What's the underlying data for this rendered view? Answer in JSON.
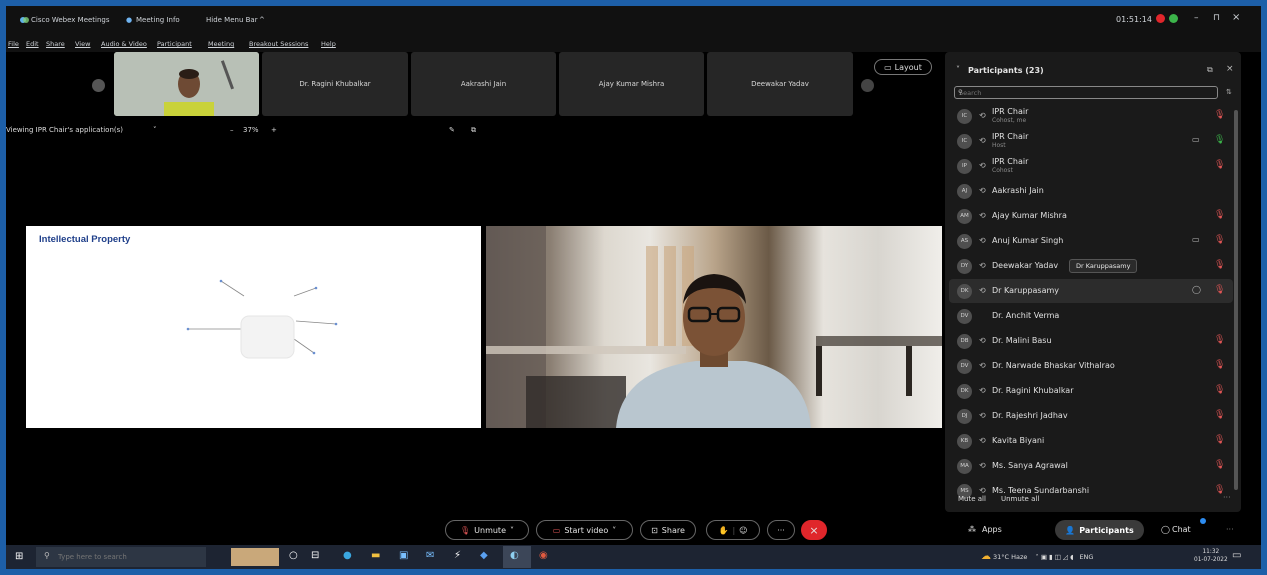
{
  "titlebar": {
    "app_name": "Cisco Webex Meetings",
    "meeting_info": "Meeting Info",
    "hide_menu": "Hide Menu Bar",
    "hide_chevron": "^",
    "timer": "01:51:14",
    "minimize": "–",
    "restore": "⊓",
    "close": "×"
  },
  "menubar": [
    "File",
    "Edit",
    "Share",
    "View",
    "Audio & Video",
    "Participant",
    "Meeting",
    "Breakout Sessions",
    "Help"
  ],
  "thumbnails": [
    {
      "name": "Dr. Ragini Khubalkar"
    },
    {
      "name": "Aakrashi Jain"
    },
    {
      "name": "Ajay Kumar Mishra"
    },
    {
      "name": "Deewakar Yadav"
    }
  ],
  "layout_button": "Layout",
  "viewing": {
    "label": "Viewing IPR Chair's application(s)",
    "minus": "–",
    "zoom": "37%",
    "plus": "+"
  },
  "share": {
    "slide_title": "Intellectual Property"
  },
  "panel": {
    "title": "Participants (23)",
    "search_placeholder": "Search",
    "tooltip": "Dr Karuppasamy",
    "mute_all": "Mute all",
    "unmute_all": "Unmute all",
    "participants": [
      {
        "initials": "IC",
        "name": "IPR Chair",
        "role": "Cohost, me",
        "mic": "muted"
      },
      {
        "initials": "IC",
        "name": "IPR Chair",
        "role": "Host",
        "mic": "active",
        "camera": true
      },
      {
        "initials": "IP",
        "name": "IPR Chair",
        "role": "Cohost",
        "mic": "muted"
      },
      {
        "initials": "AJ",
        "name": "Aakrashi Jain",
        "mic": "none"
      },
      {
        "initials": "AM",
        "name": "Ajay Kumar Mishra",
        "mic": "muted"
      },
      {
        "initials": "AS",
        "name": "Anuj Kumar Singh",
        "mic": "muted",
        "camera": true
      },
      {
        "initials": "DY",
        "name": "Deewakar Yadav",
        "mic": "muted"
      },
      {
        "initials": "DK",
        "name": "Dr Karuppasamy",
        "mic": "muted",
        "chat": true
      },
      {
        "initials": "DV",
        "name": "Dr. Anchit Verma",
        "mic": "none"
      },
      {
        "initials": "DB",
        "name": "Dr. Malini Basu",
        "mic": "muted"
      },
      {
        "initials": "DV",
        "name": "Dr. Narwade Bhaskar Vithalrao",
        "mic": "muted"
      },
      {
        "initials": "DK",
        "name": "Dr. Ragini Khubalkar",
        "mic": "muted"
      },
      {
        "initials": "DJ",
        "name": "Dr. Rajeshri Jadhav",
        "mic": "muted"
      },
      {
        "initials": "KB",
        "name": "Kavita Biyani",
        "mic": "muted"
      },
      {
        "initials": "MA",
        "name": "Ms. Sanya Agrawal",
        "mic": "muted"
      },
      {
        "initials": "MS",
        "name": "Ms. Teena Sundarbanshi",
        "mic": "muted"
      }
    ]
  },
  "controls": {
    "unmute": "Unmute",
    "start_video": "Start video",
    "share": "Share",
    "more": "···",
    "apps": "Apps",
    "participants": "Participants",
    "chat": "Chat"
  },
  "taskbar": {
    "search_placeholder": "Type here to search",
    "weather": "31°C  Haze",
    "lang": "ENG",
    "time": "11:32",
    "date": "01-07-2022"
  },
  "colors": {
    "frame_border": "#1d5fa8",
    "muted_mic": "#e05555",
    "end_call": "#e0262b",
    "slide_title": "#1f3f8a",
    "participants_tab": "#3a3a3a"
  }
}
